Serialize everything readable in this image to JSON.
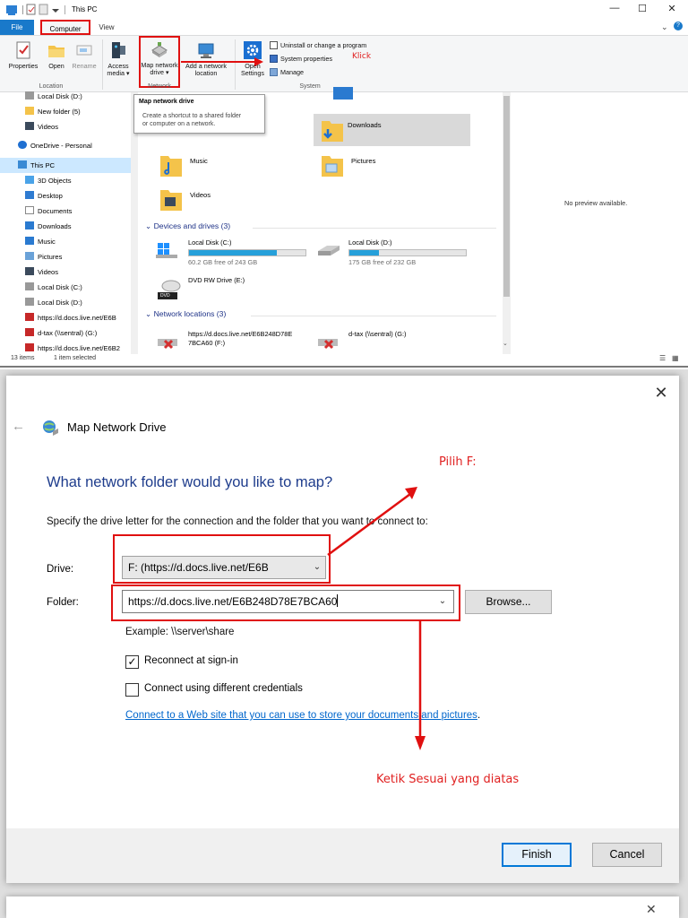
{
  "explorer": {
    "title": "This PC",
    "tabs": {
      "file": "File",
      "computer": "Computer",
      "view": "View"
    },
    "ribbon": {
      "location": {
        "label": "Location",
        "properties": "Properties",
        "open": "Open",
        "rename": "Rename"
      },
      "access_media": {
        "line1": "Access",
        "line2": "media ▾"
      },
      "network": {
        "label": "Network",
        "map_drive_line1": "Map network",
        "map_drive_line2": "drive ▾",
        "add_location_line1": "Add a network",
        "add_location_line2": "location"
      },
      "open_settings": {
        "line1": "Open",
        "line2": "Settings"
      },
      "system": {
        "label": "System",
        "uninstall": "Uninstall or change a program",
        "system_properties": "System properties",
        "manage": "Manage"
      }
    },
    "annotation_click": "Klick",
    "tooltip": {
      "title": "Map network drive",
      "line1": "Create a shortcut to a shared folder",
      "line2": "or computer on a network."
    },
    "nav": [
      {
        "label": "Local Disk (D:)"
      },
      {
        "label": "New folder (5)"
      },
      {
        "label": "Videos"
      },
      {
        "label": "OneDrive - Personal"
      },
      {
        "label": "This PC"
      },
      {
        "label": "3D Objects"
      },
      {
        "label": "Desktop"
      },
      {
        "label": "Documents"
      },
      {
        "label": "Downloads"
      },
      {
        "label": "Music"
      },
      {
        "label": "Pictures"
      },
      {
        "label": "Videos"
      },
      {
        "label": "Local Disk (C:)"
      },
      {
        "label": "Local Disk (D:)"
      },
      {
        "label": "https://d.docs.live.net/E6B"
      },
      {
        "label": "d-tax (\\\\sentral) (G:)"
      },
      {
        "label": "https://d.docs.live.net/E6B2"
      }
    ],
    "folders": {
      "downloads": "Downloads",
      "music": "Music",
      "pictures": "Pictures",
      "videos": "Videos"
    },
    "devices_header": "Devices and drives (3)",
    "drives": [
      {
        "name": "Local Disk (C:)",
        "free": "60.2 GB free of 243 GB",
        "used_fraction": 0.75
      },
      {
        "name": "Local Disk (D:)",
        "free": "175 GB free of 232 GB",
        "used_fraction": 0.25
      }
    ],
    "dvd": "DVD RW Drive (E:)",
    "dvd_badge": "DVD",
    "network_header": "Network locations (3)",
    "net_locations": [
      {
        "line1": "https://d.docs.live.net/E6B248D78E",
        "line2": "7BCA60 (F:)"
      },
      {
        "line1": "d-tax (\\\\sentral) (G:)",
        "line2": ""
      }
    ],
    "preview_text": "No preview available.",
    "status": {
      "items": "13 items",
      "selected": "1 item selected"
    }
  },
  "dialog": {
    "title": "Map Network Drive",
    "heading": "What network folder would you like to map?",
    "instruction": "Specify the drive letter for the connection and the folder that you want to connect to:",
    "drive_label": "Drive:",
    "drive_value": "F: (https://d.docs.live.net/E6B",
    "folder_label": "Folder:",
    "folder_value": "https://d.docs.live.net/E6B248D78E7BCA60",
    "browse": "Browse...",
    "example": "Example: \\\\server\\share",
    "reconnect": "Reconnect at sign-in",
    "different_credentials": "Connect using different credentials",
    "web_link": "Connect to a Web site that you can use to store your documents and pictures",
    "web_link_period": ".",
    "finish": "Finish",
    "cancel": "Cancel",
    "annotation_pilih": "Pilih F:",
    "annotation_ketik": "Ketik Sesuai yang diatas"
  },
  "colors": {
    "accent": "#0078d7",
    "annotation": "#e01010",
    "folder": "#f4c34a",
    "drive_fill": "#26a0da"
  }
}
